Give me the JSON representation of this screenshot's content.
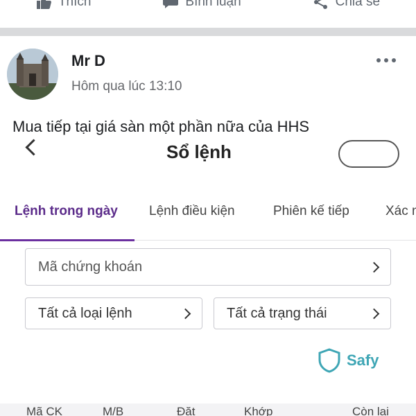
{
  "reactions": {
    "like": "Thích",
    "comment": "Bình luận",
    "share": "Chia sẻ"
  },
  "post": {
    "author": "Mr D",
    "time": "Hôm qua lúc 13:10",
    "text": "Mua tiếp tại giá sàn một phần nữa của HHS"
  },
  "screenshot": {
    "title": "Sổ lệnh",
    "tabs": [
      "Lệnh trong ngày",
      "Lệnh điều kiện",
      "Phiên kế tiếp",
      "Xác n"
    ],
    "stock_code_placeholder": "Mã chứng khoán",
    "order_type_filter": "Tất cả loại lệnh",
    "status_filter": "Tất cả trạng thái",
    "brand": "Safy",
    "columns": [
      "Mã CK",
      "M/B",
      "Đặt",
      "Khớp",
      "Còn lại"
    ],
    "accent_color": "#6b2fa0"
  }
}
